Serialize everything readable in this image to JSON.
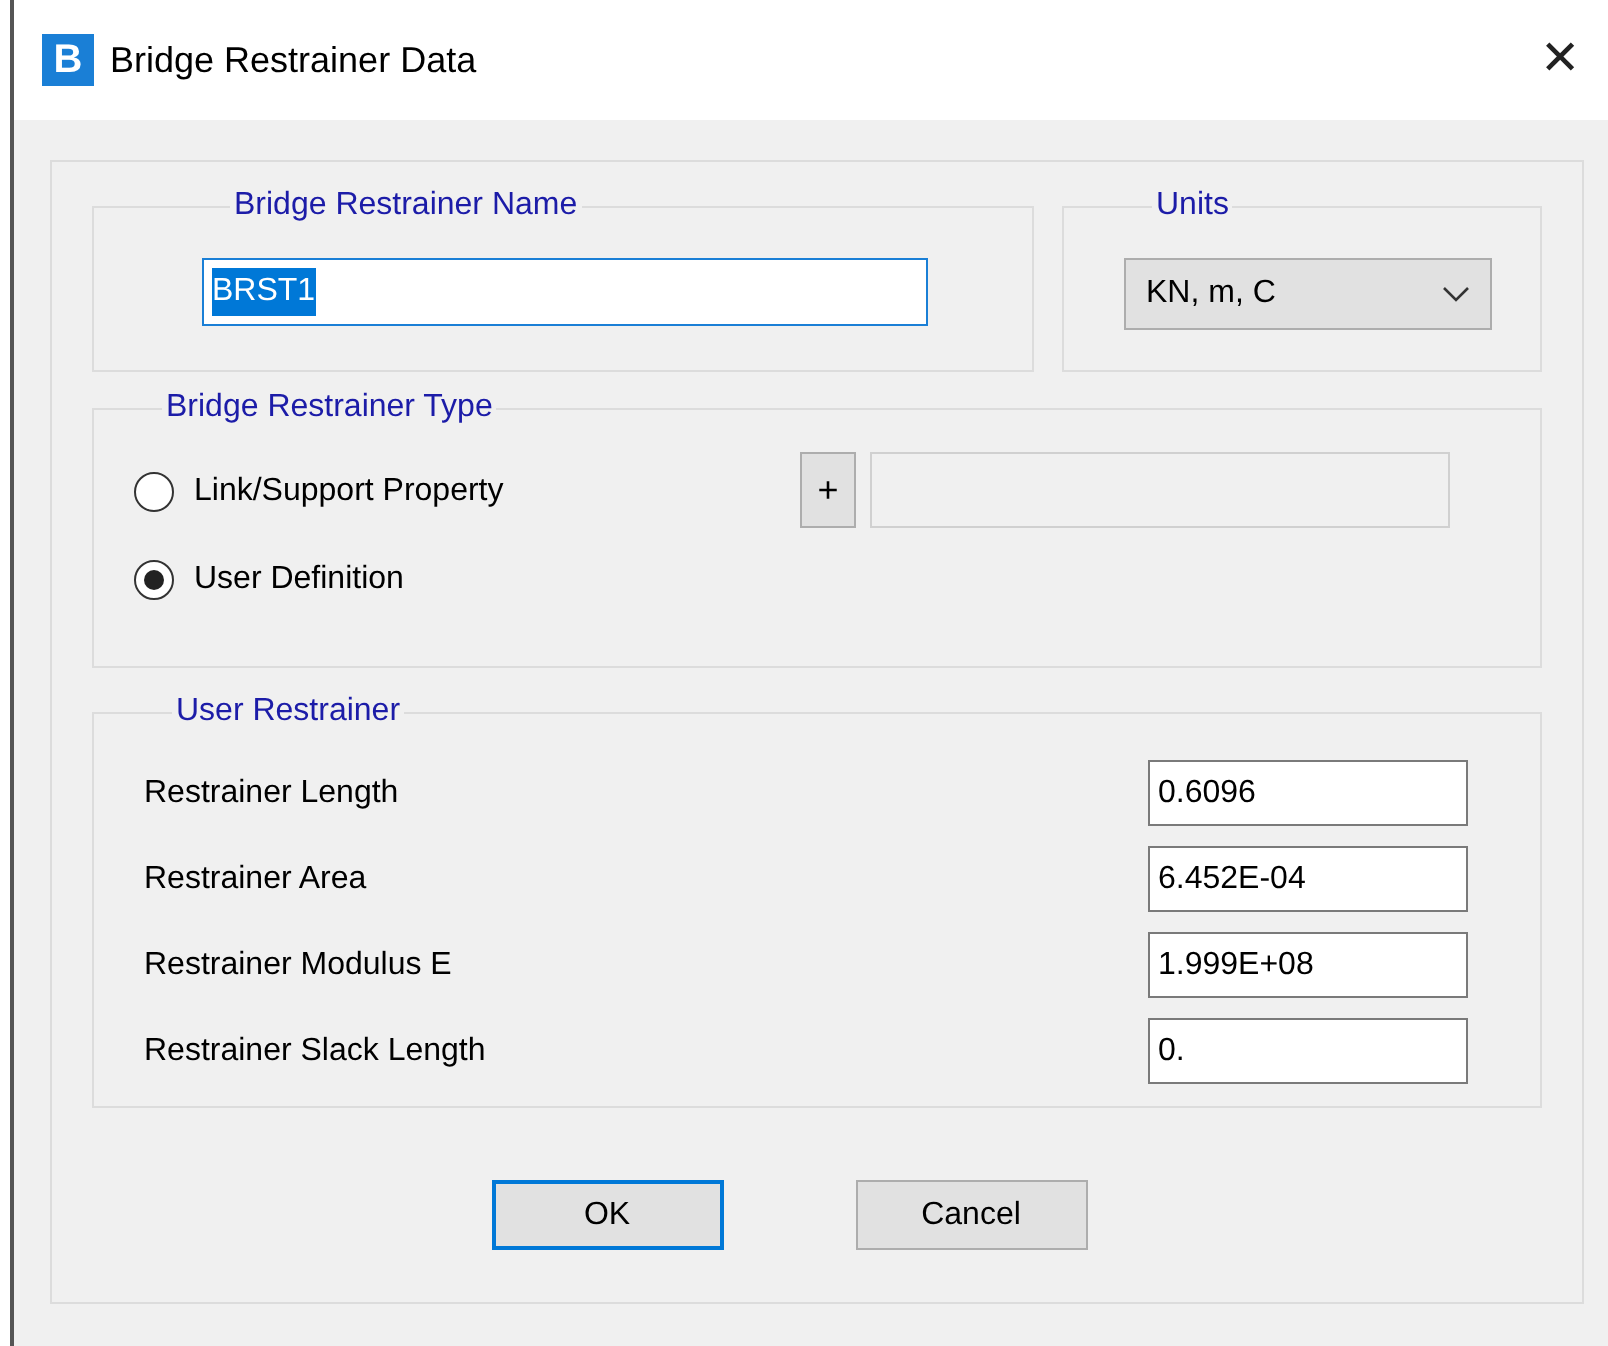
{
  "window": {
    "icon_letter": "B",
    "title": "Bridge Restrainer Data",
    "close": "✕"
  },
  "name_group": {
    "legend": "Bridge Restrainer Name",
    "value": "BRST1",
    "text_selected": true
  },
  "units_group": {
    "legend": "Units",
    "value": "KN, m, C"
  },
  "type_group": {
    "legend": "Bridge Restrainer Type",
    "add_button": "+",
    "options": [
      {
        "label": "Link/Support Property",
        "selected": false
      },
      {
        "label": "User Definition",
        "selected": true
      }
    ]
  },
  "user_group": {
    "legend": "User Restrainer",
    "rows": [
      {
        "label": "Restrainer Length",
        "value": "0.6096"
      },
      {
        "label": "Restrainer Area",
        "value": "6.452E-04"
      },
      {
        "label": "Restrainer Modulus E",
        "value": "1.999E+08"
      },
      {
        "label": "Restrainer Slack Length",
        "value": "0."
      }
    ]
  },
  "buttons": [
    {
      "label": "OK",
      "focused": true
    },
    {
      "label": "Cancel",
      "focused": false
    }
  ]
}
